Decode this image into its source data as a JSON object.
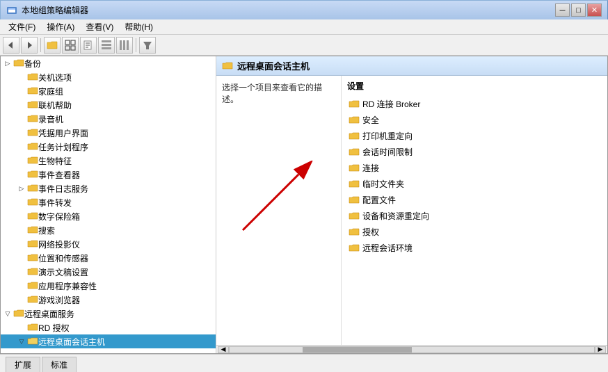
{
  "window": {
    "title": "本地组策略编辑器",
    "title_icon": "policy-icon"
  },
  "titlebar_buttons": {
    "minimize": "－",
    "maximize": "□",
    "close": "✕"
  },
  "menu": {
    "items": [
      {
        "id": "file",
        "label": "文件(F)"
      },
      {
        "id": "action",
        "label": "操作(A)"
      },
      {
        "id": "view",
        "label": "查看(V)"
      },
      {
        "id": "help",
        "label": "帮助(H)"
      }
    ]
  },
  "toolbar": {
    "buttons": [
      {
        "id": "back",
        "icon": "◀",
        "label": "后退"
      },
      {
        "id": "forward",
        "icon": "▶",
        "label": "前进"
      },
      {
        "id": "up",
        "icon": "📁",
        "label": "向上"
      },
      {
        "id": "show-hide",
        "icon": "⊞",
        "label": "显示/隐藏"
      },
      {
        "id": "export",
        "icon": "📄",
        "label": "导出"
      },
      {
        "id": "view1",
        "icon": "▦",
        "label": "视图1"
      },
      {
        "id": "view2",
        "icon": "▤",
        "label": "视图2"
      },
      {
        "id": "filter",
        "icon": "▼",
        "label": "筛选"
      }
    ]
  },
  "left_tree": {
    "items": [
      {
        "id": "backup",
        "label": "备份",
        "level": 1,
        "expandable": true,
        "expanded": false
      },
      {
        "id": "shutdown",
        "label": "关机选项",
        "level": 2,
        "expandable": false
      },
      {
        "id": "homegroup",
        "label": "家庭组",
        "level": 2,
        "expandable": false
      },
      {
        "id": "online-help",
        "label": "联机帮助",
        "level": 2,
        "expandable": false
      },
      {
        "id": "recorder",
        "label": "录音机",
        "level": 2,
        "expandable": false
      },
      {
        "id": "credential-ui",
        "label": "凭据用户界面",
        "level": 2,
        "expandable": false
      },
      {
        "id": "task-scheduler",
        "label": "任务计划程序",
        "level": 2,
        "expandable": false
      },
      {
        "id": "biometrics",
        "label": "生物特征",
        "level": 2,
        "expandable": false
      },
      {
        "id": "event-viewer",
        "label": "事件查看器",
        "level": 2,
        "expandable": false
      },
      {
        "id": "event-log-svc",
        "label": "事件日志服务",
        "level": 2,
        "expandable": true,
        "expanded": false
      },
      {
        "id": "event-forward",
        "label": "事件转发",
        "level": 2,
        "expandable": false
      },
      {
        "id": "digital-safe",
        "label": "数字保险箱",
        "level": 2,
        "expandable": false
      },
      {
        "id": "search",
        "label": "搜索",
        "level": 2,
        "expandable": false
      },
      {
        "id": "net-projector",
        "label": "网络投影仪",
        "level": 2,
        "expandable": false
      },
      {
        "id": "location-sensor",
        "label": "位置和传感器",
        "level": 2,
        "expandable": false
      },
      {
        "id": "handwriting",
        "label": "演示文稿设置",
        "level": 2,
        "expandable": false
      },
      {
        "id": "app-compat",
        "label": "应用程序兼容性",
        "level": 2,
        "expandable": false
      },
      {
        "id": "game-browser",
        "label": "游戏浏览器",
        "level": 2,
        "expandable": false
      },
      {
        "id": "remote-desktop-svc",
        "label": "远程桌面服务",
        "level": 1,
        "expandable": true,
        "expanded": true
      },
      {
        "id": "rd-auth",
        "label": "RD 授权",
        "level": 2,
        "expandable": false
      },
      {
        "id": "rd-session-host",
        "label": "远程桌面会话主机",
        "level": 2,
        "expandable": true,
        "expanded": true,
        "selected": true
      }
    ]
  },
  "right_panel": {
    "header": "远程桌面会话主机",
    "description": "选择一个项目来查看它的描述。",
    "settings_header": "设置",
    "settings_items": [
      {
        "id": "rd-broker",
        "label": "RD 连接 Broker"
      },
      {
        "id": "security",
        "label": "安全"
      },
      {
        "id": "printer-redirect",
        "label": "打印机重定向"
      },
      {
        "id": "session-timelimit",
        "label": "会话时间限制"
      },
      {
        "id": "connection",
        "label": "连接"
      },
      {
        "id": "temp-folder",
        "label": "临时文件夹"
      },
      {
        "id": "config-file",
        "label": "配置文件"
      },
      {
        "id": "device-redirect",
        "label": "设备和资源重定向"
      },
      {
        "id": "license",
        "label": "授权"
      },
      {
        "id": "remote-session-env",
        "label": "远程会话环境"
      }
    ]
  },
  "tabs": [
    {
      "id": "expand",
      "label": "扩展",
      "active": false
    },
    {
      "id": "standard",
      "label": "标准",
      "active": false
    }
  ],
  "colors": {
    "title_bar_start": "#c8daf5",
    "title_bar_end": "#a8c4e8",
    "toolbar_bg": "#f0f0f0",
    "right_header_bg": "#ddeeff",
    "selected_bg": "#3399cc",
    "arrow_color": "#cc0000"
  }
}
